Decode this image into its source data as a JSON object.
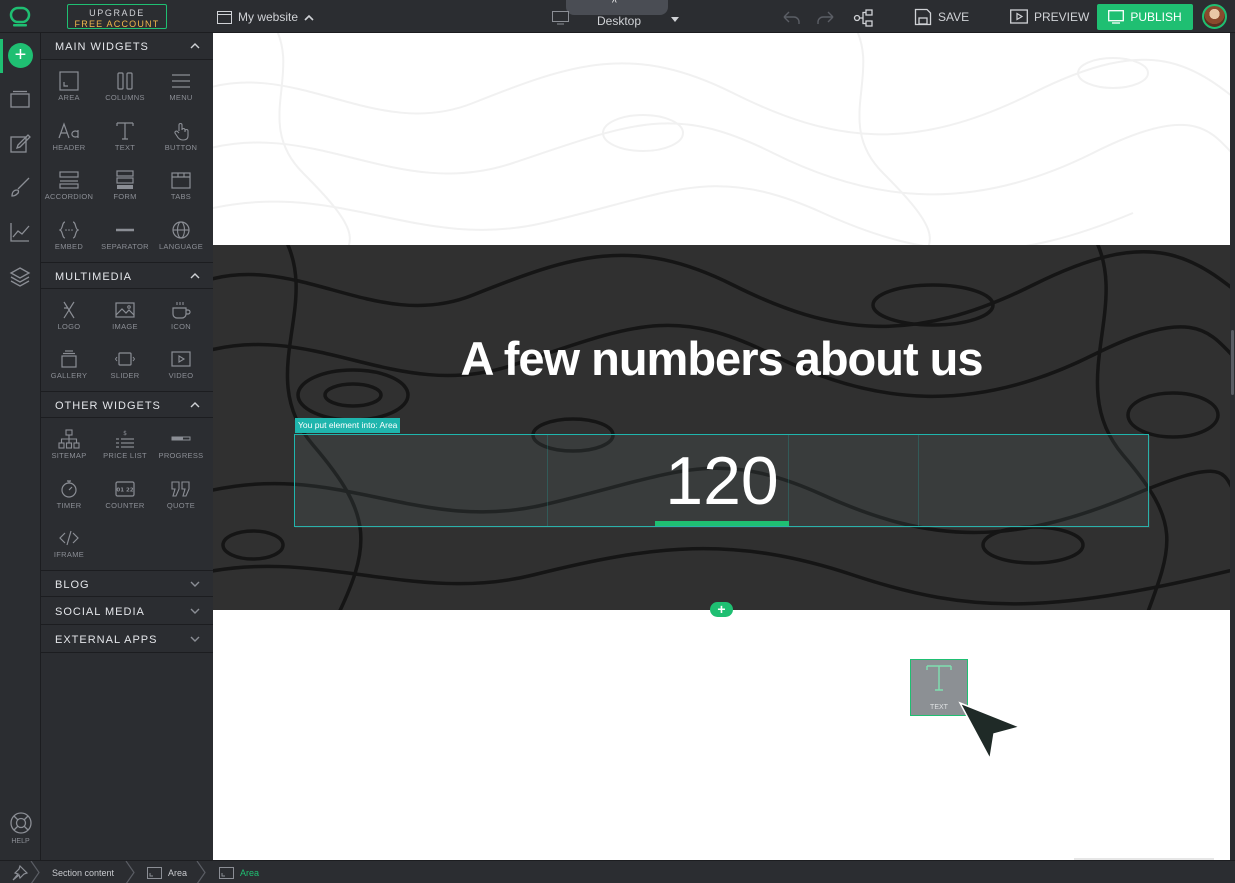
{
  "topbar": {
    "upgrade_line1": "UPGRADE",
    "upgrade_line2": "FREE ACCOUNT",
    "site_name": "My website",
    "device_tab_label": "^",
    "device_label": "Desktop",
    "save_label": "SAVE",
    "preview_label": "PREVIEW",
    "publish_label": "PUBLISH"
  },
  "rail": {
    "add_label": "+",
    "help_label": "HELP"
  },
  "panel": {
    "main_title": "MAIN WIDGETS",
    "main_widgets": [
      "AREA",
      "COLUMNS",
      "MENU",
      "HEADER",
      "TEXT",
      "BUTTON",
      "ACCORDION",
      "FORM",
      "TABS",
      "EMBED",
      "SEPARATOR",
      "LANGUAGE"
    ],
    "multimedia_title": "MULTIMEDIA",
    "multimedia_widgets": [
      "LOGO",
      "IMAGE",
      "ICON",
      "GALLERY",
      "SLIDER",
      "VIDEO"
    ],
    "other_title": "OTHER WIDGETS",
    "other_widgets": [
      "SITEMAP",
      "PRICE LIST",
      "PROGRESS",
      "TIMER",
      "COUNTER",
      "QUOTE",
      "IFRAME"
    ],
    "blog_title": "BLOG",
    "social_title": "SOCIAL MEDIA",
    "external_title": "EXTERNAL APPS"
  },
  "canvas": {
    "heading": "A few numbers about us",
    "drop_tooltip": "You put element into: Area",
    "counter_value": "120",
    "counter_icon_text": "01 22",
    "add_section_label": "+",
    "dragged_widget_label": "TEXT"
  },
  "breadcrumb": {
    "items": [
      "Section content",
      "Area",
      "Area"
    ]
  },
  "colors": {
    "accent": "#1fbf72",
    "selection": "#1fb5ad",
    "toolbar_bg": "#2b2d31",
    "upgrade_text": "#f2b84b"
  }
}
